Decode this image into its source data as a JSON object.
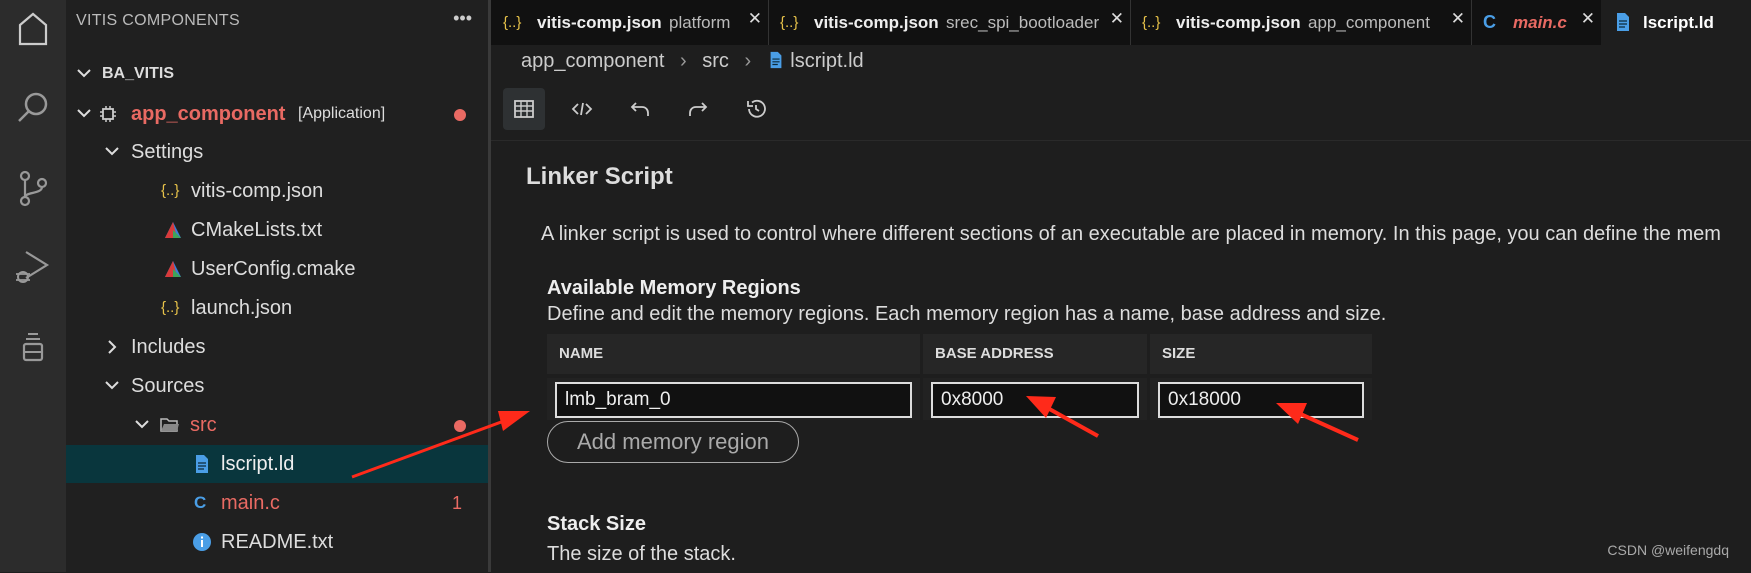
{
  "activity_bar": {
    "icons": [
      "home-icon",
      "search-icon",
      "source-control-icon",
      "run-debug-icon",
      "extensions-icon"
    ]
  },
  "sidebar": {
    "title": "VITIS COMPONENTS",
    "more": "•••",
    "workspace": "BA_VITIS",
    "component": {
      "name": "app_component",
      "tag": "[Application]"
    },
    "settings": "Settings",
    "settings_items": [
      "vitis-comp.json",
      "CMakeLists.txt",
      "UserConfig.cmake",
      "launch.json"
    ],
    "includes": "Includes",
    "sources": "Sources",
    "src": "src",
    "src_items": [
      "lscript.ld",
      "main.c",
      "README.txt"
    ],
    "main_c_problems": "1",
    "json_icon": "{..}"
  },
  "tabs": [
    {
      "name": "vitis-comp.json",
      "desc": "platform",
      "icon": "{..}"
    },
    {
      "name": "vitis-comp.json",
      "desc": "srec_spi_bootloader",
      "icon": "{..}"
    },
    {
      "name": "vitis-comp.json",
      "desc": "app_component",
      "icon": "{..}"
    },
    {
      "name": "main.c",
      "desc": "",
      "icon": "C"
    },
    {
      "name": "lscript.ld",
      "desc": "",
      "icon": ""
    }
  ],
  "tab_close": "✕",
  "breadcrumb": [
    "app_component",
    "src",
    "lscript.ld"
  ],
  "breadcrumb_sep": "›",
  "toolbar": [
    "table-view-icon",
    "code-view-icon",
    "undo-icon",
    "redo-icon",
    "history-icon"
  ],
  "linker": {
    "title": "Linker Script",
    "description": "A linker script is used to control where different sections of an executable are placed in memory. In this page, you can define the mem",
    "regions_title": "Available Memory Regions",
    "regions_desc": "Define and edit the memory regions. Each memory region has a name, base address and size.",
    "columns": [
      "NAME",
      "BASE ADDRESS",
      "SIZE"
    ],
    "rows": [
      {
        "name": "lmb_bram_0",
        "base": "0x8000",
        "size": "0x18000"
      }
    ],
    "add_button": "Add memory region",
    "stack_title": "Stack Size",
    "stack_desc": "The size of the stack."
  },
  "watermark": "CSDN @weifengdq",
  "colors": {
    "accent_red": "#e96a63",
    "arrow_red": "#ff2a1a",
    "json_yellow": "#e8c34a",
    "file_blue": "#4a9ee6",
    "selected_bg": "#09363d"
  }
}
